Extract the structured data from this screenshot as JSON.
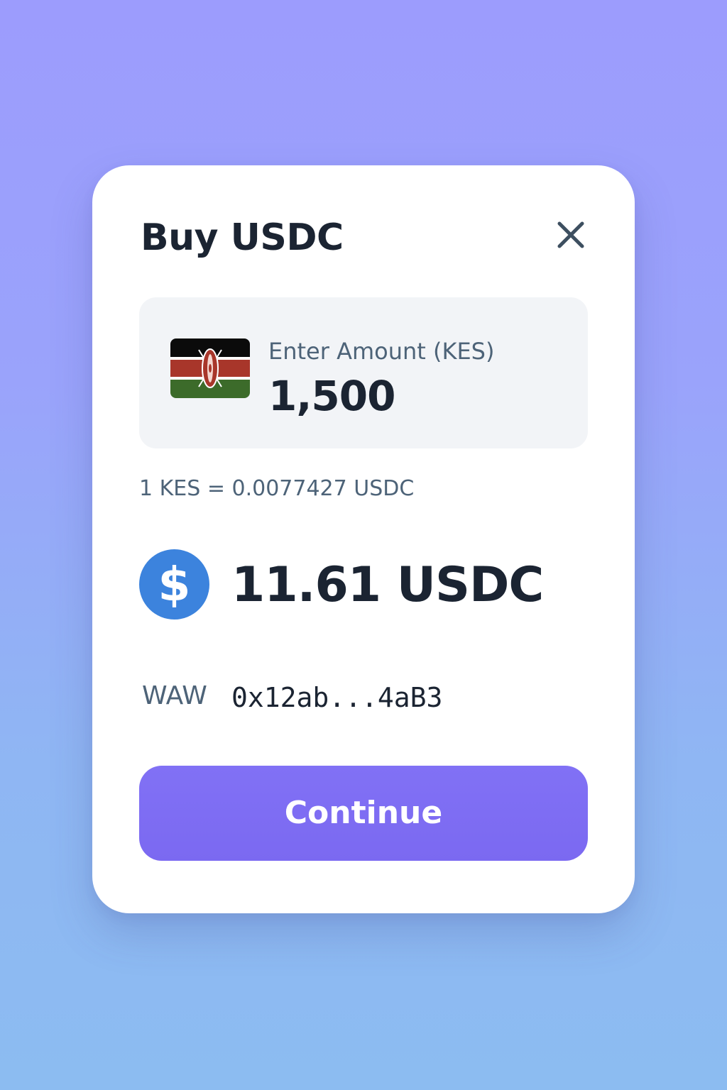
{
  "dialog": {
    "title": "Buy USDC",
    "close_icon": "close-icon"
  },
  "amount_input": {
    "currency_flag_icon": "kenya-flag-icon",
    "label": "Enter Amount (KES)",
    "value": "1,500"
  },
  "exchange_rate": "1 KES = 0.0077427 USDC",
  "receive": {
    "token_icon": "usdc-icon",
    "amount": "11.61 USDC"
  },
  "wallet": {
    "label": "WAW",
    "address": "0x12ab...4aB3"
  },
  "actions": {
    "continue_label": "Continue"
  },
  "colors": {
    "accent": "#7d6cf3",
    "usdc_blue": "#3c83dd",
    "text_primary": "#1b2432",
    "text_secondary": "#4d6378"
  }
}
